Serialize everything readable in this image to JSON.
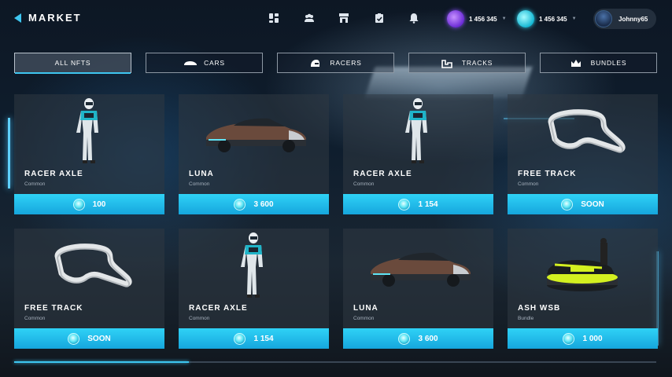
{
  "header": {
    "title": "MARKET",
    "nav_icons": [
      "dashboard-icon",
      "team-icon",
      "store-icon",
      "tasks-icon",
      "notifications-icon"
    ],
    "wallets": [
      {
        "currency": "purple",
        "amount": "1 456 345"
      },
      {
        "currency": "cyan",
        "amount": "1 456 345"
      }
    ],
    "user": {
      "name": "Johnny65"
    }
  },
  "filters": [
    {
      "label": "ALL NFTS",
      "icon": "",
      "active": true
    },
    {
      "label": "CARS",
      "icon": "car-icon",
      "active": false
    },
    {
      "label": "RACERS",
      "icon": "helmet-icon",
      "active": false
    },
    {
      "label": "TRACKS",
      "icon": "track-icon",
      "active": false
    },
    {
      "label": "BUNDLES",
      "icon": "crown-icon",
      "active": false
    }
  ],
  "cards": [
    {
      "title": "RACER AXLE",
      "rarity": "Common",
      "price": "100",
      "visual": "racer-figure"
    },
    {
      "title": "LUNA",
      "rarity": "Common",
      "price": "3 600",
      "visual": "car-image"
    },
    {
      "title": "RACER AXLE",
      "rarity": "Common",
      "price": "1 154",
      "visual": "racer-figure"
    },
    {
      "title": "FREE TRACK",
      "rarity": "Common",
      "price": "SOON",
      "visual": "track-model"
    },
    {
      "title": "FREE TRACK",
      "rarity": "Common",
      "price": "SOON",
      "visual": "track-model"
    },
    {
      "title": "RACER AXLE",
      "rarity": "Common",
      "price": "1 154",
      "visual": "racer-figure"
    },
    {
      "title": "LUNA",
      "rarity": "Common",
      "price": "3 600",
      "visual": "car-image"
    },
    {
      "title": "ASH WSB",
      "rarity": "Bundle",
      "price": "1 000",
      "visual": "bundle-image"
    }
  ],
  "colors": {
    "accent": "#3ec6f0",
    "price_bar": "#1fb8e8"
  }
}
